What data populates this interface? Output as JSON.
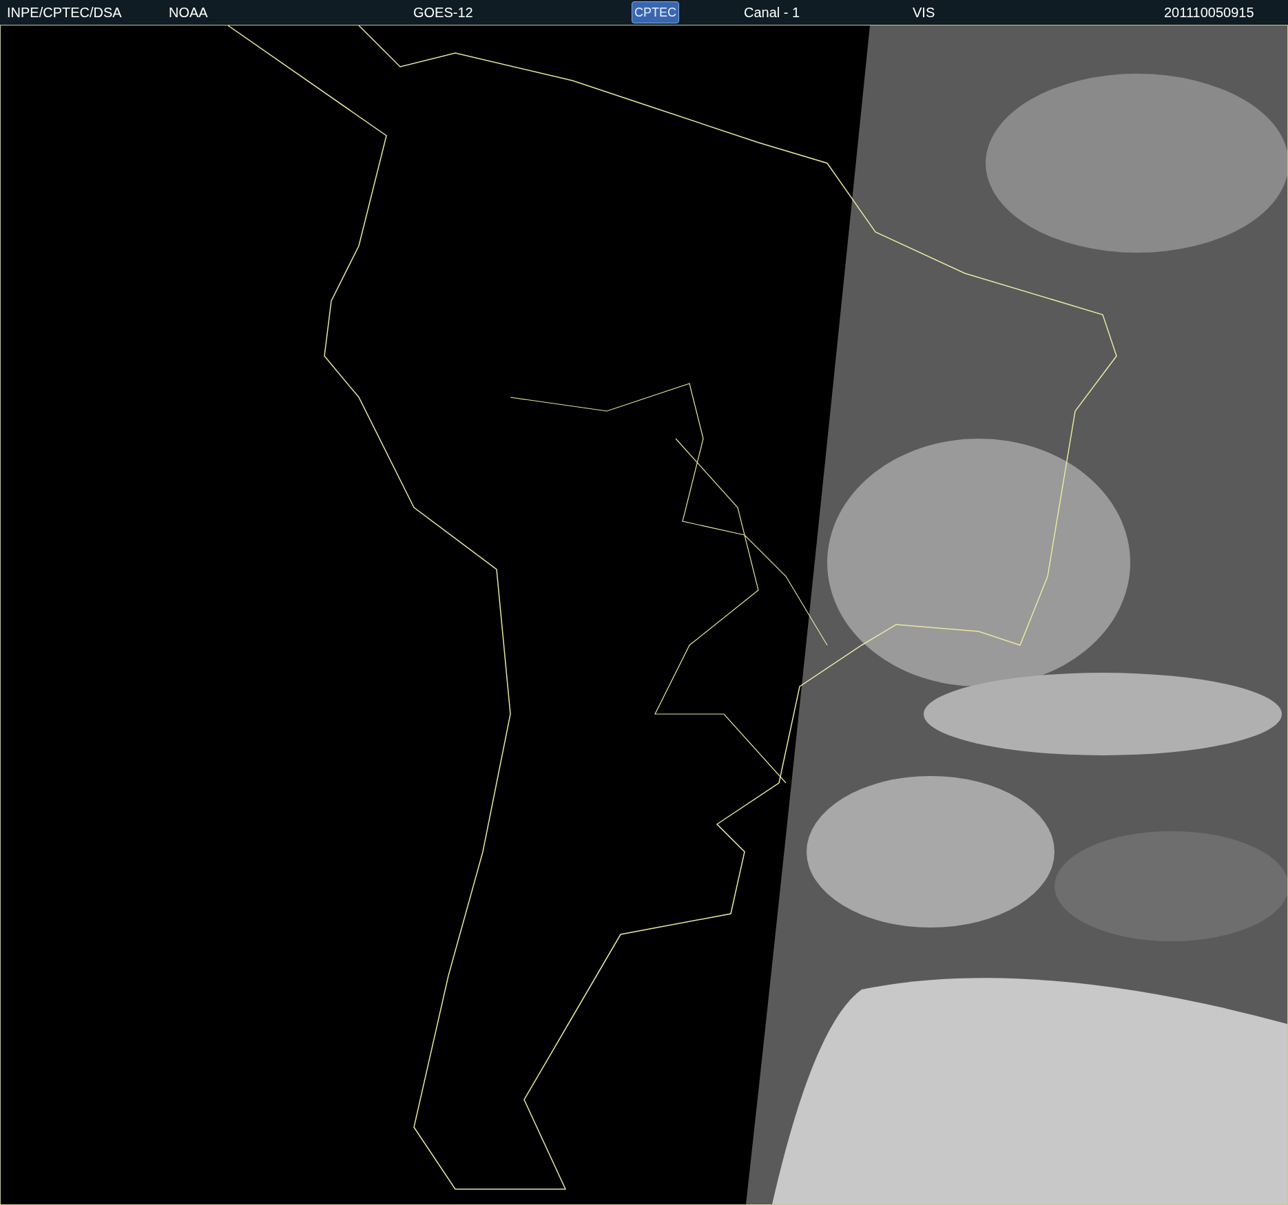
{
  "header": {
    "items": [
      {
        "kind": "text",
        "text": "INPE/CPTEC/DSA"
      },
      {
        "kind": "text",
        "text": "NOAA"
      },
      {
        "kind": "text",
        "text": "GOES-12"
      },
      {
        "kind": "logo",
        "text": "CPTEC"
      },
      {
        "kind": "text",
        "text": "Canal - 1"
      },
      {
        "kind": "text",
        "text": "VIS"
      },
      {
        "kind": "text",
        "text": "201110050915"
      }
    ]
  }
}
